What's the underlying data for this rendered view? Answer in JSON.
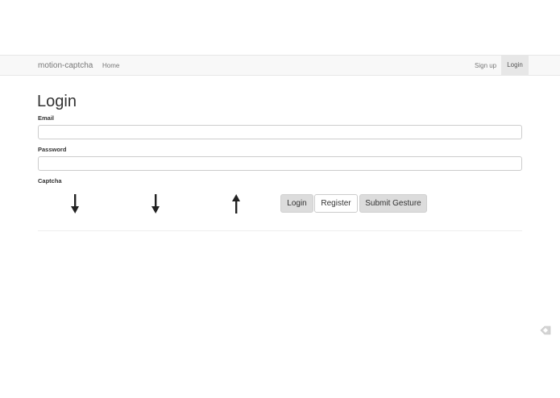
{
  "navbar": {
    "brand": "motion-captcha",
    "home": "Home",
    "signup": "Sign up",
    "login": "Login"
  },
  "form": {
    "title": "Login",
    "email_label": "Email",
    "email_value": "",
    "password_label": "Password",
    "password_value": "",
    "captcha_label": "Captcha",
    "captcha_sequence": [
      "arrow-down-icon",
      "arrow-down-icon",
      "arrow-up-icon"
    ]
  },
  "buttons": {
    "login": "Login",
    "register": "Register",
    "submit_gesture": "Submit Gesture"
  },
  "colors": {
    "navbar_bg": "#f8f8f8",
    "active_nav_bg": "#e7e7e7",
    "button_gray": "#dcdcdc",
    "arrow": "#222222"
  }
}
